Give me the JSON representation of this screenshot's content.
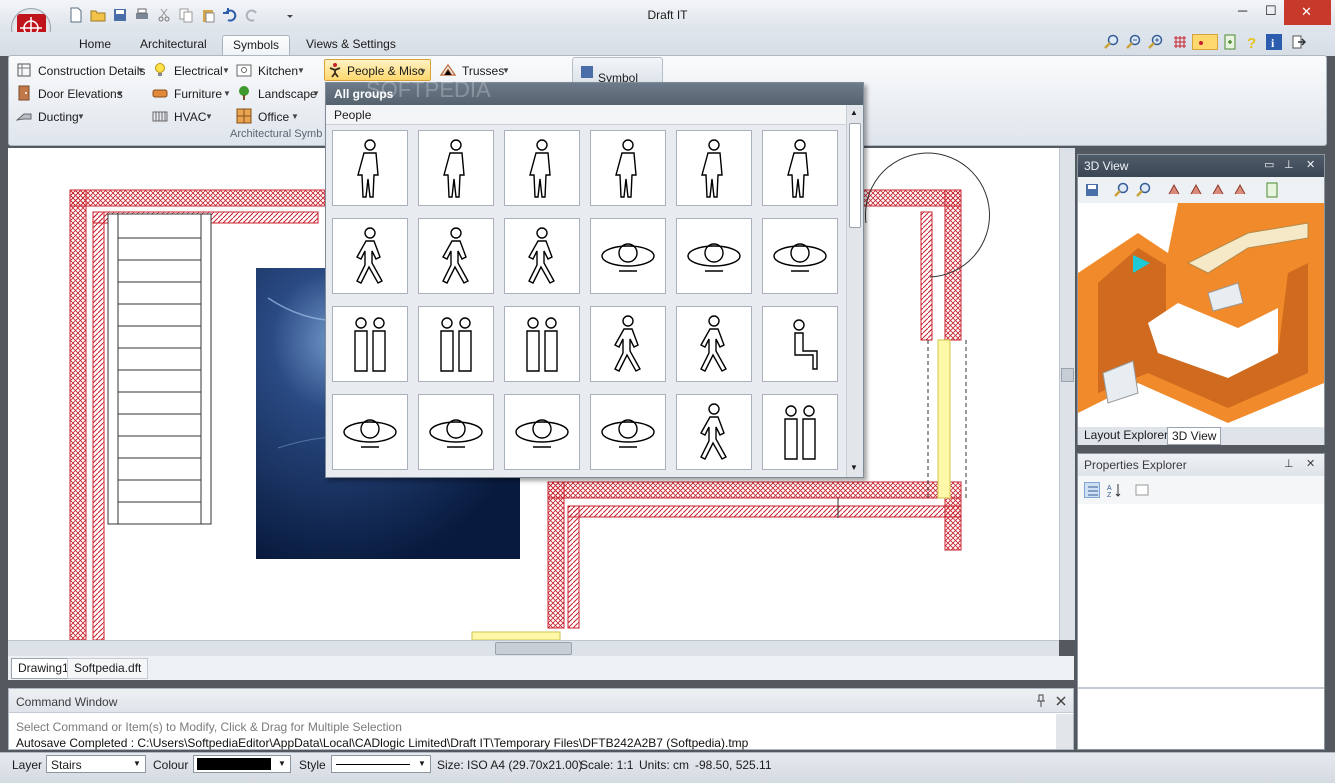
{
  "window": {
    "title": "Draft IT",
    "min_glyph": "─",
    "max_glyph": "☐",
    "close_glyph": "✕"
  },
  "tabs": [
    {
      "label": "Home"
    },
    {
      "label": "Architectural"
    },
    {
      "label": "Symbols",
      "active": true
    },
    {
      "label": "Views & Settings"
    }
  ],
  "ribbon": {
    "group_caption": "Architectural Symb",
    "buttons": {
      "construction_details": "Construction Details",
      "electrical": "Electrical",
      "kitchen": "Kitchen",
      "people_misc": "People & Misc",
      "trusses": "Trusses",
      "door_elevations": "Door Elevations",
      "furniture": "Furniture",
      "landscape": "Landscape",
      "ducting": "Ducting",
      "hvac": "HVAC",
      "office": "Office",
      "symbol": "Symbol"
    }
  },
  "dropdown": {
    "header": "All groups",
    "subheader": "People",
    "watermark": "SOFTPEDIA",
    "thumbnails_count_note": "",
    "symbols": [
      {
        "name": "person-standing-coat"
      },
      {
        "name": "person-standing-suit"
      },
      {
        "name": "person-standing-hands-hips"
      },
      {
        "name": "person-standing-front"
      },
      {
        "name": "person-standing-briefcase"
      },
      {
        "name": "person-standing-back"
      },
      {
        "name": "person-walking-1"
      },
      {
        "name": "person-leaning"
      },
      {
        "name": "person-walking-2"
      },
      {
        "name": "person-top-lying"
      },
      {
        "name": "person-top-desk"
      },
      {
        "name": "person-top-standing"
      },
      {
        "name": "couple-standing"
      },
      {
        "name": "businessmen-handshake"
      },
      {
        "name": "couple-dancing"
      },
      {
        "name": "woman-pointing"
      },
      {
        "name": "person-vacuuming"
      },
      {
        "name": "person-sitting"
      },
      {
        "name": "person-top-small"
      },
      {
        "name": "person-top-table"
      },
      {
        "name": "person-top-large"
      },
      {
        "name": "group-working"
      },
      {
        "name": "person-kneeling"
      },
      {
        "name": "couple-walking"
      }
    ]
  },
  "panels": {
    "view3d_title": "3D View",
    "layout_tab": "Layout Explorer",
    "view3d_tab": "3D View",
    "properties_title": "Properties Explorer"
  },
  "doc_tabs": [
    "Drawing1",
    "Softpedia.dft"
  ],
  "command_window": {
    "title": "Command Window",
    "prompt": "Select Command or Item(s) to Modify, Click & Drag for Multiple Selection",
    "last_message": "Autosave Completed : C:\\Users\\SoftpediaEditor\\AppData\\Local\\CADlogic Limited\\Draft IT\\Temporary Files\\DFTB242A2B7 (Softpedia).tmp"
  },
  "status": {
    "layer_label": "Layer",
    "layer_value": "Stairs",
    "colour_label": "Colour",
    "colour_value": "#000000",
    "style_label": "Style",
    "size": "Size: ISO A4 (29.70x21.00)",
    "scale": "Scale: 1:1",
    "units": "Units: cm",
    "coords": "-98.50, 525.11"
  },
  "colors": {
    "accent": "#3a4653",
    "hatch": "#c8202c",
    "wall3d": "#f08a2a",
    "highlight": "#ffd86e"
  }
}
